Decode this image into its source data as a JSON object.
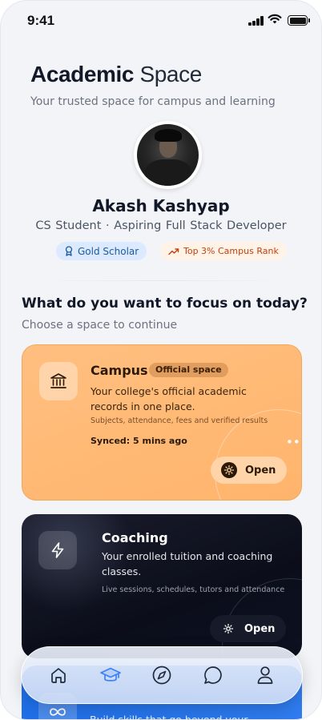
{
  "status": {
    "time": "9:41"
  },
  "header": {
    "title_bold": "Academic",
    "title_light": "Space",
    "subtitle": "Your trusted space for campus and learning"
  },
  "profile": {
    "name": "Akash Kashyap",
    "role": "CS Student · Aspiring Full Stack Developer",
    "badges": [
      {
        "label": "Gold Scholar",
        "icon": "award-icon",
        "color": "#1e5a9c"
      },
      {
        "label": "Top 3% Campus Rank",
        "icon": "trending-up-icon",
        "color": "#c2410c"
      }
    ]
  },
  "focus": {
    "heading": "What do you want to focus on today?",
    "subheading": "Choose a space to continue"
  },
  "cards": {
    "campus": {
      "icon": "institution-icon",
      "title": "Campus",
      "tag": "Official space",
      "description": "Your college's official academic records in one place.",
      "detail": "Subjects, attendance, fees and verified results",
      "synced": "Synced: 5 mins ago",
      "open_label": "Open",
      "accent": "#ffb46c"
    },
    "coaching": {
      "icon": "lightning-icon",
      "title": "Coaching",
      "description": "Your enrolled tuition and coaching classes.",
      "detail": "Live sessions, schedules, tutors and attendance",
      "open_label": "Open",
      "accent": "#0b0e1a"
    },
    "learning": {
      "icon": "infinity-icon",
      "description": "Build skills that go beyond your",
      "accent": "#1f6fe8"
    }
  },
  "nav": {
    "items": [
      {
        "icon": "home-icon",
        "active": false
      },
      {
        "icon": "graduation-cap-icon",
        "active": true
      },
      {
        "icon": "compass-icon",
        "active": false
      },
      {
        "icon": "chat-icon",
        "active": false
      },
      {
        "icon": "profile-icon",
        "active": false
      }
    ],
    "active_color": "#3b82f6"
  }
}
